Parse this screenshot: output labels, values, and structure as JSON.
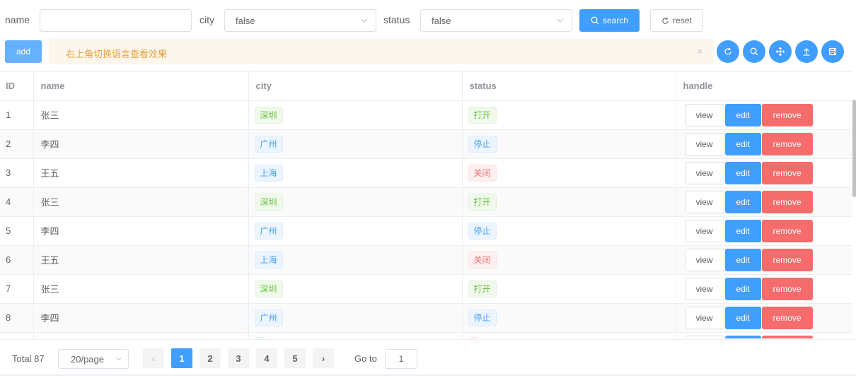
{
  "filters": {
    "name_label": "name",
    "name_value": "",
    "city_label": "city",
    "city_value": "false",
    "status_label": "status",
    "status_value": "false",
    "search_label": "search",
    "reset_label": "reset"
  },
  "toolbar": {
    "add_label": "add",
    "alert_text": "右上角切换语言查看效果",
    "alert_close": "×",
    "icons": [
      "refresh-icon",
      "search-icon",
      "move-icon",
      "upload-icon",
      "save-icon"
    ]
  },
  "table": {
    "columns": [
      "ID",
      "name",
      "city",
      "status",
      "handle"
    ],
    "rows": [
      {
        "id": "1",
        "name": "张三",
        "city": "深圳",
        "city_type": "success",
        "status": "打开",
        "status_type": "success"
      },
      {
        "id": "2",
        "name": "李四",
        "city": "广州",
        "city_type": "primary",
        "status": "停止",
        "status_type": "primary"
      },
      {
        "id": "3",
        "name": "王五",
        "city": "上海",
        "city_type": "primary",
        "status": "关闭",
        "status_type": "danger"
      },
      {
        "id": "4",
        "name": "张三",
        "city": "深圳",
        "city_type": "success",
        "status": "打开",
        "status_type": "success"
      },
      {
        "id": "5",
        "name": "李四",
        "city": "广州",
        "city_type": "primary",
        "status": "停止",
        "status_type": "primary"
      },
      {
        "id": "6",
        "name": "王五",
        "city": "上海",
        "city_type": "primary",
        "status": "关闭",
        "status_type": "danger"
      },
      {
        "id": "7",
        "name": "张三",
        "city": "深圳",
        "city_type": "success",
        "status": "打开",
        "status_type": "success"
      },
      {
        "id": "8",
        "name": "李四",
        "city": "广州",
        "city_type": "primary",
        "status": "停止",
        "status_type": "primary"
      },
      {
        "id": "",
        "name": "",
        "city": "",
        "city_type": "primary",
        "status": "",
        "status_type": "danger"
      }
    ],
    "actions": {
      "view": "view",
      "edit": "edit",
      "remove": "remove"
    }
  },
  "pagination": {
    "total_label": "Total 87",
    "page_size": "20/page",
    "pages": [
      "1",
      "2",
      "3",
      "4",
      "5"
    ],
    "current_page": "1",
    "prev": "‹",
    "next": "›",
    "goto_label": "Go to",
    "goto_value": "1"
  }
}
